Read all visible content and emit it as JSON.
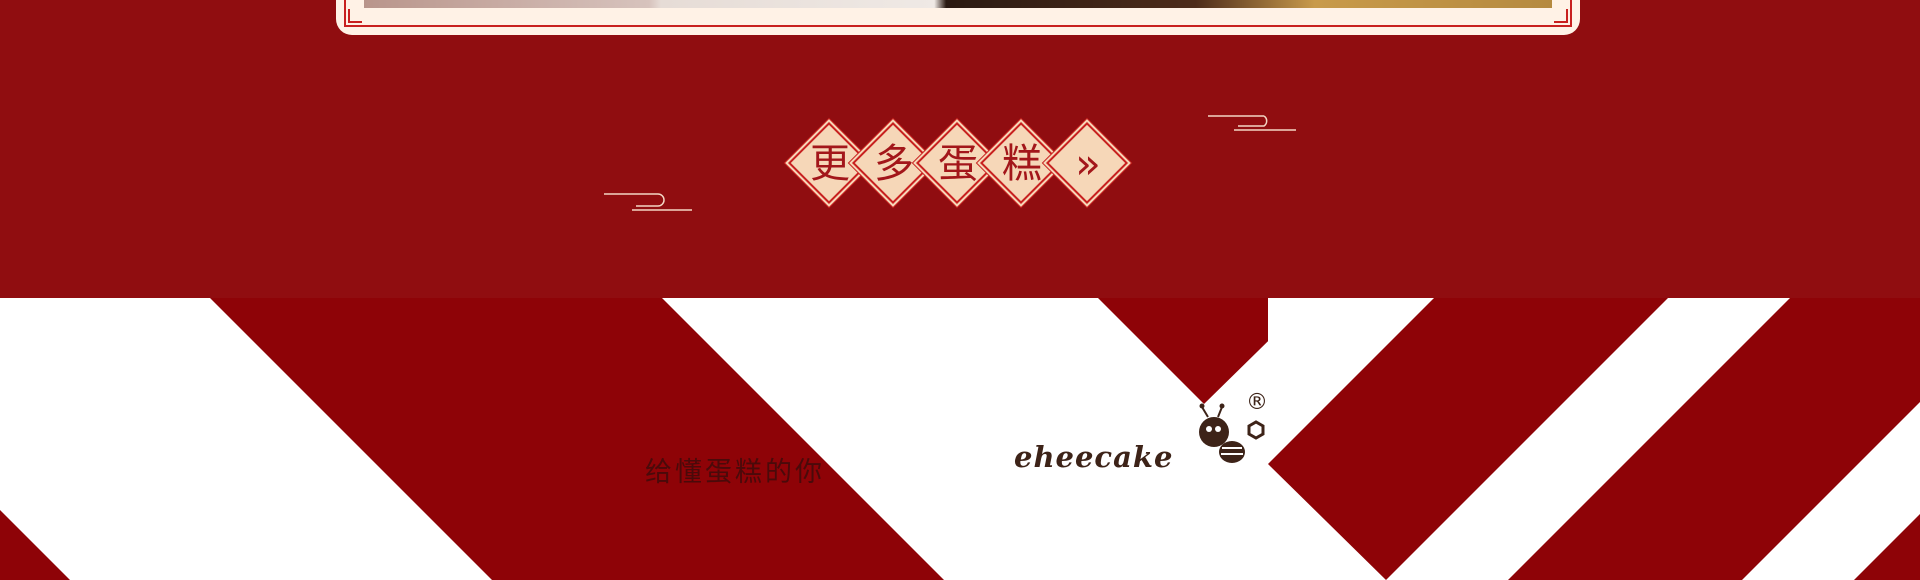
{
  "more_button": {
    "chars": [
      "更",
      "多",
      "蛋",
      "糕",
      "»"
    ]
  },
  "footer": {
    "tagline": "给懂蛋糕的你",
    "brand_name": "eheecake",
    "registered_mark": "®"
  },
  "colors": {
    "brand_red": "#900d10",
    "stripe_red": "#8e0307",
    "cream": "#f6d7b8",
    "logo_brown": "#3d2318"
  }
}
